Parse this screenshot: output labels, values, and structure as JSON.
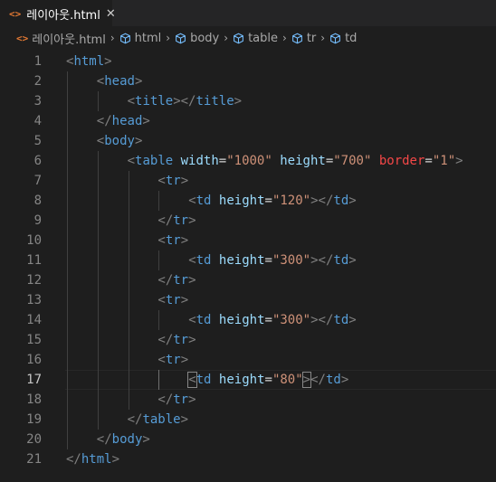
{
  "tab": {
    "title": "레이아웃.html",
    "icon": "html-file-icon"
  },
  "breadcrumb": {
    "file": "레이아웃.html",
    "path": [
      "html",
      "body",
      "table",
      "tr",
      "td"
    ]
  },
  "editor": {
    "active_line": 17,
    "lines": [
      {
        "n": "1",
        "indent": 0,
        "tokens": [
          [
            "p",
            "<"
          ],
          [
            "t",
            "html"
          ],
          [
            "p",
            ">"
          ]
        ]
      },
      {
        "n": "2",
        "indent": 1,
        "tokens": [
          [
            "p",
            "<"
          ],
          [
            "t",
            "head"
          ],
          [
            "p",
            ">"
          ]
        ]
      },
      {
        "n": "3",
        "indent": 2,
        "tokens": [
          [
            "p",
            "<"
          ],
          [
            "t",
            "title"
          ],
          [
            "p",
            "></"
          ],
          [
            "t",
            "title"
          ],
          [
            "p",
            ">"
          ]
        ]
      },
      {
        "n": "4",
        "indent": 1,
        "tokens": [
          [
            "p",
            "</"
          ],
          [
            "t",
            "head"
          ],
          [
            "p",
            ">"
          ]
        ]
      },
      {
        "n": "5",
        "indent": 1,
        "tokens": [
          [
            "p",
            "<"
          ],
          [
            "t",
            "body"
          ],
          [
            "p",
            ">"
          ]
        ]
      },
      {
        "n": "6",
        "indent": 2,
        "tokens": [
          [
            "p",
            "<"
          ],
          [
            "t",
            "table"
          ],
          [
            "eq",
            " "
          ],
          [
            "a",
            "width"
          ],
          [
            "eq",
            "="
          ],
          [
            "s",
            "\"1000\""
          ],
          [
            "eq",
            " "
          ],
          [
            "a",
            "height"
          ],
          [
            "eq",
            "="
          ],
          [
            "s",
            "\"700\""
          ],
          [
            "eq",
            " "
          ],
          [
            "ad",
            "border"
          ],
          [
            "eq",
            "="
          ],
          [
            "s",
            "\"1\""
          ],
          [
            "p",
            ">"
          ]
        ]
      },
      {
        "n": "7",
        "indent": 3,
        "tokens": [
          [
            "p",
            "<"
          ],
          [
            "t",
            "tr"
          ],
          [
            "p",
            ">"
          ]
        ]
      },
      {
        "n": "8",
        "indent": 4,
        "tokens": [
          [
            "p",
            "<"
          ],
          [
            "t",
            "td"
          ],
          [
            "eq",
            " "
          ],
          [
            "a",
            "height"
          ],
          [
            "eq",
            "="
          ],
          [
            "s",
            "\"120\""
          ],
          [
            "p",
            "></"
          ],
          [
            "t",
            "td"
          ],
          [
            "p",
            ">"
          ]
        ]
      },
      {
        "n": "9",
        "indent": 3,
        "tokens": [
          [
            "p",
            "</"
          ],
          [
            "t",
            "tr"
          ],
          [
            "p",
            ">"
          ]
        ]
      },
      {
        "n": "10",
        "indent": 3,
        "tokens": [
          [
            "p",
            "<"
          ],
          [
            "t",
            "tr"
          ],
          [
            "p",
            ">"
          ]
        ]
      },
      {
        "n": "11",
        "indent": 4,
        "tokens": [
          [
            "p",
            "<"
          ],
          [
            "t",
            "td"
          ],
          [
            "eq",
            " "
          ],
          [
            "a",
            "height"
          ],
          [
            "eq",
            "="
          ],
          [
            "s",
            "\"300\""
          ],
          [
            "p",
            "></"
          ],
          [
            "t",
            "td"
          ],
          [
            "p",
            ">"
          ]
        ]
      },
      {
        "n": "12",
        "indent": 3,
        "tokens": [
          [
            "p",
            "</"
          ],
          [
            "t",
            "tr"
          ],
          [
            "p",
            ">"
          ]
        ]
      },
      {
        "n": "13",
        "indent": 3,
        "tokens": [
          [
            "p",
            "<"
          ],
          [
            "t",
            "tr"
          ],
          [
            "p",
            ">"
          ]
        ]
      },
      {
        "n": "14",
        "indent": 4,
        "tokens": [
          [
            "p",
            "<"
          ],
          [
            "t",
            "td"
          ],
          [
            "eq",
            " "
          ],
          [
            "a",
            "height"
          ],
          [
            "eq",
            "="
          ],
          [
            "s",
            "\"300\""
          ],
          [
            "p",
            "></"
          ],
          [
            "t",
            "td"
          ],
          [
            "p",
            ">"
          ]
        ]
      },
      {
        "n": "15",
        "indent": 3,
        "tokens": [
          [
            "p",
            "</"
          ],
          [
            "t",
            "tr"
          ],
          [
            "p",
            ">"
          ]
        ]
      },
      {
        "n": "16",
        "indent": 3,
        "tokens": [
          [
            "p",
            "<"
          ],
          [
            "t",
            "tr"
          ],
          [
            "p",
            ">"
          ]
        ]
      },
      {
        "n": "17",
        "indent": 4,
        "tokens": [
          [
            "pb",
            "<"
          ],
          [
            "t",
            "td"
          ],
          [
            "eq",
            " "
          ],
          [
            "a",
            "height"
          ],
          [
            "eq",
            "="
          ],
          [
            "s",
            "\"80\""
          ],
          [
            "pb",
            ">"
          ],
          [
            "p",
            "</"
          ],
          [
            "t",
            "td"
          ],
          [
            "p",
            ">"
          ]
        ]
      },
      {
        "n": "18",
        "indent": 3,
        "tokens": [
          [
            "p",
            "</"
          ],
          [
            "t",
            "tr"
          ],
          [
            "p",
            ">"
          ]
        ]
      },
      {
        "n": "19",
        "indent": 2,
        "tokens": [
          [
            "p",
            "</"
          ],
          [
            "t",
            "table"
          ],
          [
            "p",
            ">"
          ]
        ]
      },
      {
        "n": "20",
        "indent": 1,
        "tokens": [
          [
            "p",
            "</"
          ],
          [
            "t",
            "body"
          ],
          [
            "p",
            ">"
          ]
        ]
      },
      {
        "n": "21",
        "indent": 0,
        "tokens": [
          [
            "p",
            "</"
          ],
          [
            "t",
            "html"
          ],
          [
            "p",
            ">"
          ]
        ]
      }
    ]
  },
  "colors": {
    "background": "#1e1e1e",
    "tag": "#569cd6",
    "attribute": "#9cdcfe",
    "string": "#ce9178",
    "deprecated_attribute": "#f44747",
    "file_icon": "#e37933"
  }
}
